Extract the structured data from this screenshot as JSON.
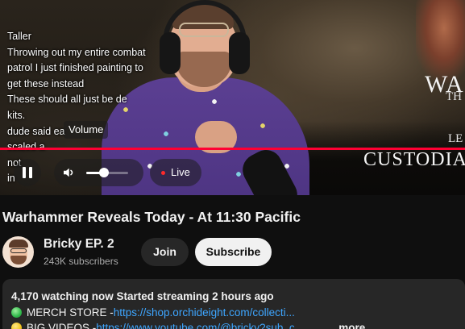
{
  "player": {
    "chat_lines": [
      "Taller",
      "Throwing out my entire combat",
      "patrol I just finished painting to",
      "get these instead",
      "These should all just be de",
      "kits.",
      "dude said ea",
      "scaled a",
      "not",
      "in"
    ],
    "volume_tooltip": "Volume",
    "live_label": "Live",
    "overlay_title": "WA",
    "overlay_sub": "TH",
    "overlay_le": "LE",
    "overlay_custodia": "CUSTODIA",
    "accent": "#ff0033"
  },
  "video": {
    "title": "Warhammer Reveals Today - At 11:30 Pacific"
  },
  "channel": {
    "name": "Bricky EP. 2",
    "subscribers": "243K subscribers",
    "join_label": "Join",
    "subscribe_label": "Subscribe"
  },
  "description": {
    "meta": "4,170 watching now  Started streaming 2 hours ago",
    "line1_label": "MERCH STORE - ",
    "line1_link": "https://shop.orchideight.com/collecti...",
    "line2_label": "BIG VIDEOS - ",
    "line2_link": "https://www.youtube.com/@bricky?sub_c...",
    "more_label": "...more"
  }
}
